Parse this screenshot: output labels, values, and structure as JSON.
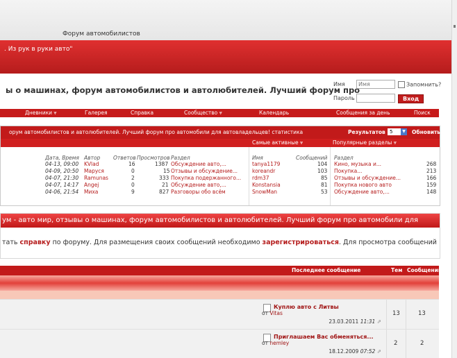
{
  "site": {
    "name": "Форум автомобилистов",
    "tagline": ". Из рук в руки авто\""
  },
  "headline": "ы о машинах, форум автомобилистов и автолюбителей. Лучший форум про",
  "login": {
    "name_label": "Имя",
    "name_placeholder": "Имя",
    "remember_label": "Запомнить?",
    "password_label": "Пароль",
    "submit_label": "Вход"
  },
  "nav": {
    "items": [
      "Дневники ⩔",
      "Галерея",
      "Справка",
      "Сообщество ⩔",
      "Календарь",
      "Сообщения за день",
      "Поиск"
    ]
  },
  "whats_new": {
    "title": "орум автомобилистов и автолюбителей. Лучший форум про автомобили для автовладельцев! статистика",
    "results_label": "Результатов",
    "results_value": "5",
    "refresh_label": "Обновить",
    "most_active_label": "Самые активные ⩔",
    "popular_sections_label": "Популярные разделы ⩔",
    "columns": {
      "date": "Дата, Время",
      "author": "Автор",
      "replies": "Ответов",
      "views": "Просмотров",
      "section": "Раздел"
    },
    "posts": [
      {
        "date": "04-13, 09:00",
        "author": "KVlad",
        "replies": "16",
        "views": "1387",
        "section": "Обсуждение авто,..."
      },
      {
        "date": "04-09, 20:50",
        "author": "Маруся",
        "replies": "0",
        "views": "15",
        "section": "Отзывы и обсуждение..."
      },
      {
        "date": "04-07, 21:30",
        "author": "Ramunas",
        "replies": "2",
        "views": "333",
        "section": "Покупка подержанного..."
      },
      {
        "date": "04-07, 14:17",
        "author": "Angej",
        "replies": "0",
        "views": "21",
        "section": "Обсуждение авто,..."
      },
      {
        "date": "04-06, 21:54",
        "author": "Миха",
        "replies": "9",
        "views": "827",
        "section": "Разговоры обо всём"
      }
    ],
    "active_columns": {
      "name": "Имя",
      "posts": "Сообщений"
    },
    "active_users": [
      {
        "name": "tanya1179",
        "posts": "104"
      },
      {
        "name": "koreandr",
        "posts": "103"
      },
      {
        "name": "rdm37",
        "posts": "85"
      },
      {
        "name": "Konstansia",
        "posts": "81"
      },
      {
        "name": "SnowMan",
        "posts": "53"
      }
    ],
    "popular_columns": {
      "section": "Раздел"
    },
    "popular_sections": [
      {
        "name": "Кино, музыка и...",
        "count": "268"
      },
      {
        "name": "Покупка...",
        "count": "213"
      },
      {
        "name": "Отзывы и обсуждение...",
        "count": "166"
      },
      {
        "name": "Покупка нового авто",
        "count": "159"
      },
      {
        "name": "Обсуждение авто,...",
        "count": "148"
      }
    ]
  },
  "welcome": {
    "title": "ум - авто мир, отзывы о машинах, форум автомобилистов и автолюбителей. Лучший форум про автомобили для",
    "text_1": "тать ",
    "link_help": "справку",
    "text_2": " по форуму. Для размещения своих сообщений необходимо ",
    "link_register": "зарегистрироваться",
    "text_3": ". Для просмотра сообщений"
  },
  "forum": {
    "col_last_post": "Последнее сообщение",
    "col_topics": "Тем",
    "col_posts": "Сообщений",
    "rows": [
      {
        "title": "Куплю авто с Литвы",
        "by_prefix": "от",
        "author": "Vitas",
        "date": "23.03.2011",
        "time": "11:31",
        "topics": "13",
        "posts": "13"
      },
      {
        "title": "Приглашаем Вас обменяться...",
        "by_prefix": "от",
        "author": "nemley",
        "date": "18.12.2009",
        "time": "07:52",
        "topics": "2",
        "posts": "2"
      }
    ]
  }
}
